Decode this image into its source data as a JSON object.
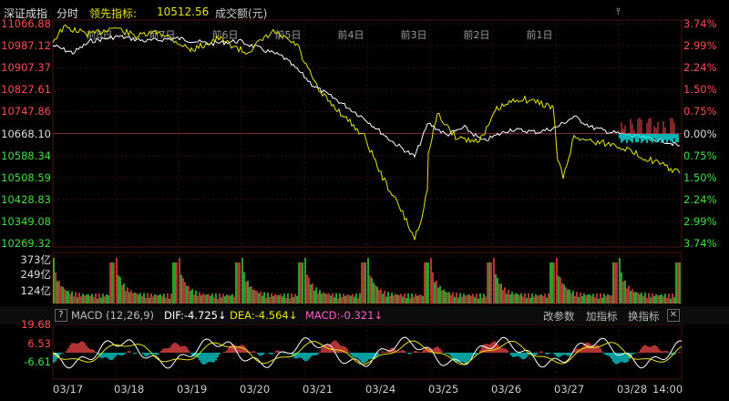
{
  "header": {
    "title": "深证成指",
    "mode": "分时",
    "leader_label": "领先指标:",
    "leader_value": "10512.56",
    "volume_label": "成交额(元)",
    "pin_icon": "pin-icon"
  },
  "price_axis": {
    "left": [
      "11066.88",
      "10987.12",
      "10907.37",
      "10827.61",
      "10747.86",
      "10668.10",
      "10588.34",
      "10508.59",
      "10428.83",
      "10349.08",
      "10269.32"
    ],
    "right": [
      "3.74%",
      "2.99%",
      "2.24%",
      "1.50%",
      "0.75%",
      "0.00%",
      "0.75%",
      "1.50%",
      "2.24%",
      "2.99%",
      "3.74%"
    ]
  },
  "day_labels": [
    "前8日",
    "前7日",
    "前6日",
    "前5日",
    "前4日",
    "前3日",
    "前2日",
    "前1日"
  ],
  "volume_axis": [
    "373亿",
    "249亿",
    "124亿"
  ],
  "macd": {
    "help": "?",
    "title": "MACD (12,26,9)",
    "dif": "DIF:-4.725↓",
    "dea": "DEA:-4.564↓",
    "macd": "MACD:-0.321↓",
    "btn_params": "改参数",
    "btn_add": "加指标",
    "btn_switch": "换指标",
    "btn_close": "✕",
    "axis": [
      "19.68",
      "6.53",
      "-6.61"
    ]
  },
  "dates": [
    "03/17",
    "03/18",
    "03/19",
    "03/20",
    "03/21",
    "03/24",
    "03/25",
    "03/26",
    "03/27",
    "03/28"
  ],
  "end_time": "14:00",
  "colors": {
    "up": "#ff4b4b",
    "down": "#3ee03e",
    "yellow": "#e6e600",
    "white": "#ffffff",
    "cyan": "#00e0e0",
    "grid": "#3a1010"
  }
}
